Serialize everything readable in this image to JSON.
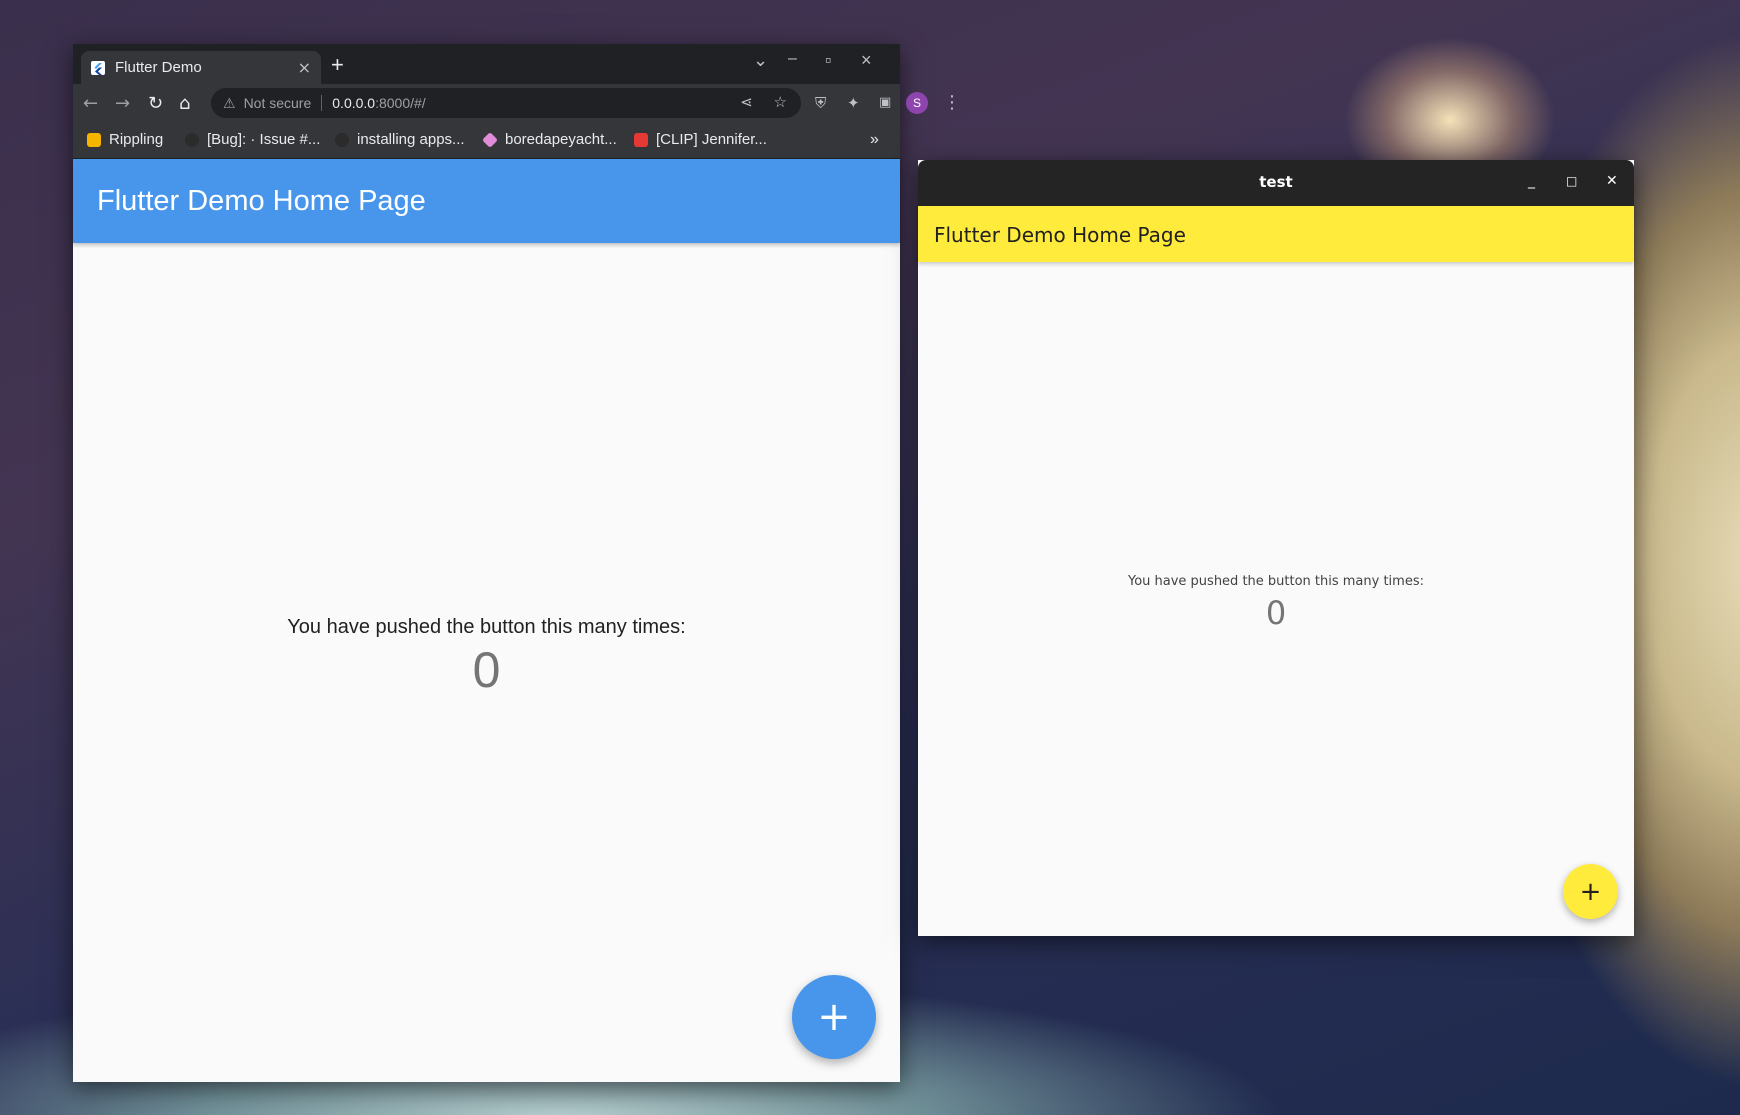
{
  "chrome": {
    "tab_title": "Flutter Demo",
    "tab_close": "×",
    "new_tab": "+",
    "controls": {
      "dropdown": "⌄",
      "minimize": "–",
      "maximize": "▫",
      "close": "×"
    },
    "nav": {
      "back": "←",
      "forward": "→",
      "reload": "↻",
      "home": "⌂"
    },
    "omnibox": {
      "security_icon": "⚠",
      "security_text": "Not secure",
      "host": "0.0.0.0",
      "path": ":8000/#/",
      "share_icon": "⋖",
      "star_icon": "☆"
    },
    "extensions": {
      "shield": "⛨",
      "puzzle": "✦",
      "sidepanel": "▣",
      "menu": "⋮"
    },
    "avatar_letter": "S",
    "bookmarks": [
      {
        "label": "Rippling",
        "color": "#f5b400"
      },
      {
        "label": "[Bug]: · Issue #...",
        "color": "#2b2b2b"
      },
      {
        "label": "installing apps...",
        "color": "#2b2b2b"
      },
      {
        "label": "boredapeyacht...",
        "color": "#e08cd8"
      },
      {
        "label": "[CLIP] Jennifer...",
        "color": "#e53935"
      }
    ],
    "bookmarks_overflow": "»"
  },
  "web_app": {
    "appbar_title": "Flutter Demo Home Page",
    "appbar_color": "#4796eb",
    "counter_label": "You have pushed the button this many times:",
    "counter_value": "0",
    "fab_icon": "+"
  },
  "native_window": {
    "title": "test",
    "controls": {
      "minimize": "_",
      "maximize": "□",
      "close": "✕"
    },
    "appbar_title": "Flutter Demo Home Page",
    "appbar_color": "#ffeb3b",
    "counter_label": "You have pushed the button this many times:",
    "counter_value": "0",
    "fab_icon": "+"
  }
}
